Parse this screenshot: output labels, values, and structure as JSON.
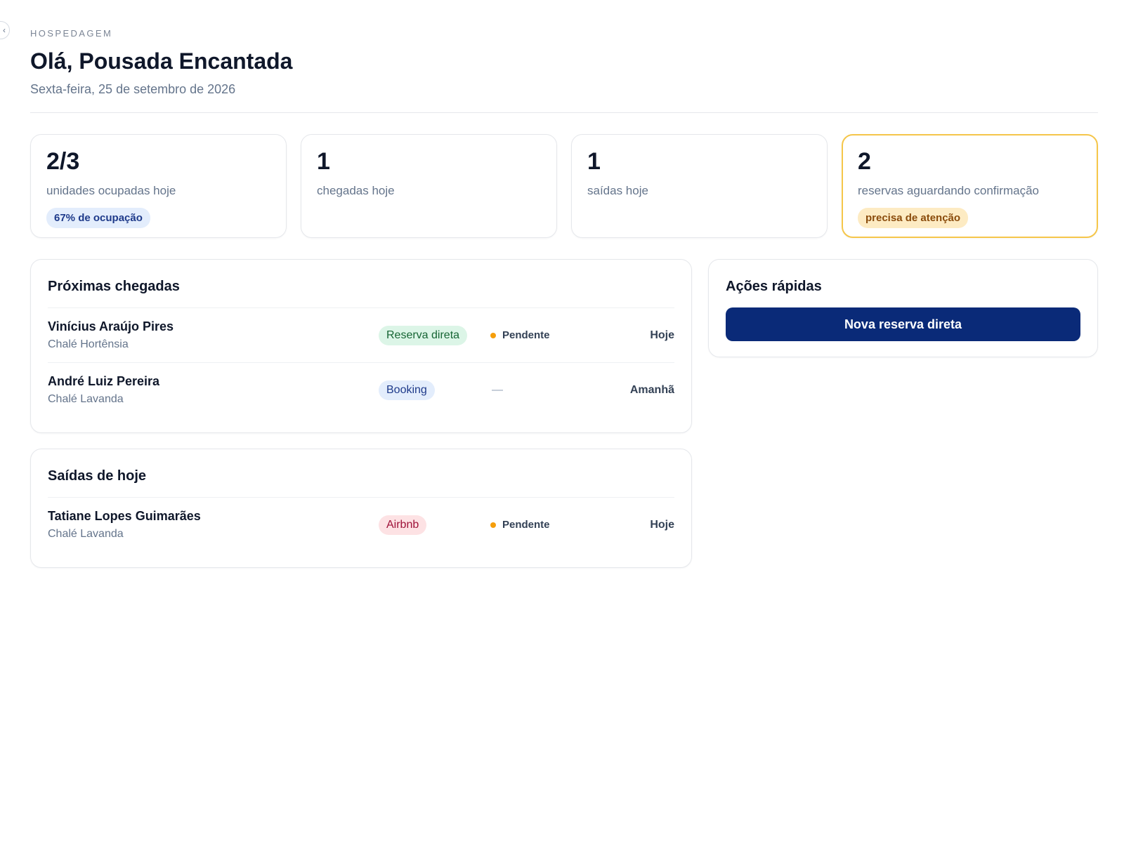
{
  "sidebar_toggle": {
    "icon": "chevron-left-icon",
    "glyph": "‹"
  },
  "header": {
    "eyebrow": "HOSPEDAGEM",
    "title": "Olá, Pousada Encantada",
    "date": "Sexta-feira, 25 de setembro de 2026"
  },
  "stats": [
    {
      "value": "2/3",
      "label": "unidades ocupadas hoje",
      "pill": "67% de ocupação",
      "pill_tone": "blue"
    },
    {
      "value": "1",
      "label": "chegadas hoje"
    },
    {
      "value": "1",
      "label": "saídas hoje"
    },
    {
      "value": "2",
      "label": "reservas aguardando confirmação",
      "pill": "precisa de atenção",
      "pill_tone": "amber",
      "highlight_color": "#f5c64a"
    }
  ],
  "arrivals": {
    "title": "Próximas chegadas",
    "rows": [
      {
        "name": "Vinícius Araújo Pires",
        "unit": "Chalé Hortênsia",
        "channel": "Reserva direta",
        "channel_tone": "green",
        "status": "Pendente",
        "when": "Hoje"
      },
      {
        "name": "André Luiz Pereira",
        "unit": "Chalé Lavanda",
        "channel": "Booking",
        "channel_tone": "blue",
        "status": "—",
        "when": "Amanhã"
      }
    ]
  },
  "departures": {
    "title": "Saídas de hoje",
    "rows": [
      {
        "name": "Tatiane Lopes Guimarães",
        "unit": "Chalé Lavanda",
        "channel": "Airbnb",
        "channel_tone": "red",
        "status": "Pendente",
        "when": "Hoje"
      }
    ]
  },
  "quick_actions": {
    "title": "Ações rápidas",
    "primary_label": "Nova reserva direta"
  },
  "colors": {
    "primary": "#0a2a78",
    "pending_dot": "#f59e0b",
    "attention_border": "#f5c64a"
  }
}
